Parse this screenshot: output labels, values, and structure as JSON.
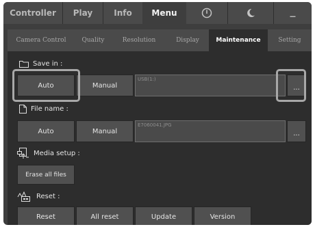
{
  "top_tabs": {
    "controller": "Controller",
    "play": "Play",
    "info": "Info",
    "menu": "Menu",
    "minimize": "_"
  },
  "sub_tabs": {
    "camera_control": "Camera Control",
    "quality": "Quality",
    "resolution": "Resolution",
    "display": "Display",
    "maintenance": "Maintenance",
    "setting": "Setting"
  },
  "save_in": {
    "label": "Save in :",
    "auto": "Auto",
    "manual": "Manual",
    "path": "USB(1:)",
    "browse": "..."
  },
  "file_name": {
    "label": "File name :",
    "auto": "Auto",
    "manual": "Manual",
    "value": "E7060041.JPG",
    "browse": "..."
  },
  "media_setup": {
    "label": "Media setup :",
    "erase": "Erase all files"
  },
  "reset": {
    "label": "Reset :",
    "reset": "Reset",
    "all_reset": "All reset",
    "update": "Update",
    "version": "Version"
  },
  "icons": [
    "power-icon",
    "moon-icon",
    "folder-icon",
    "file-icon",
    "media-setup-icon",
    "reset-icon"
  ]
}
